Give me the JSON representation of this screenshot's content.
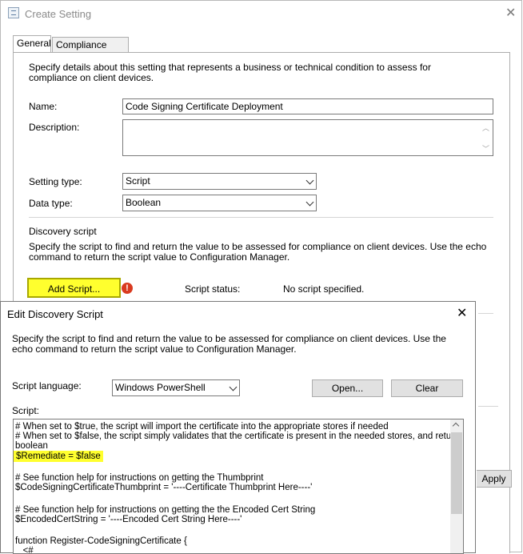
{
  "outer": {
    "title": "Create Setting",
    "tabs": [
      "General",
      "Compliance Rules"
    ],
    "intro": "Specify details about this setting that represents a business or technical condition to assess for compliance on client devices.",
    "name_label": "Name:",
    "name_value": "Code Signing Certificate Deployment",
    "description_label": "Description:",
    "description_value": "",
    "setting_type_label": "Setting type:",
    "setting_type_value": "Script",
    "data_type_label": "Data type:",
    "data_type_value": "Boolean",
    "discovery_heading": "Discovery script",
    "discovery_desc": "Specify the script to find and return the value to be assessed for compliance on client devices. Use the echo command to return the script value to Configuration Manager.",
    "add_script_label": "Add Script...",
    "script_status_label": "Script status:",
    "script_status_value": "No script specified.",
    "apply_label": "Apply"
  },
  "inner": {
    "title": "Edit Discovery Script",
    "desc": "Specify the script to find and return the value to be assessed for compliance on client devices. Use the echo command to return the script value to Configuration Manager.",
    "language_label": "Script language:",
    "language_value": "Windows PowerShell",
    "open_label": "Open...",
    "clear_label": "Clear",
    "script_label": "Script:",
    "script_lines": [
      "# When set to $true, the script will import the certificate into the appropriate stores if needed",
      "# When set to $false, the script simply validates that the certificate is present in the needed stores, and returns a",
      "boolean",
      "$Remediate = $false",
      "",
      "# See function help for instructions on getting the Thumbprint",
      "$CodeSigningCertificateThumbprint = '----Certificate Thumbprint Here----'",
      "",
      "# See function help for instructions on getting the the Encoded Cert String",
      "$EncodedCertString = '----Encoded Cert String Here----'",
      "",
      "function Register-CodeSigningCertificate {",
      "   <#"
    ]
  },
  "colors": {
    "highlight": "#ffff2e",
    "warning": "#d93a1f"
  }
}
